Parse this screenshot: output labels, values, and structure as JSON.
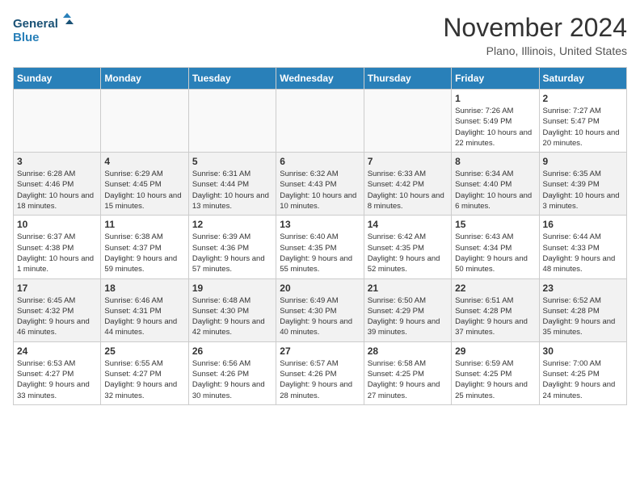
{
  "header": {
    "logo_line1": "General",
    "logo_line2": "Blue",
    "month": "November 2024",
    "location": "Plano, Illinois, United States"
  },
  "weekdays": [
    "Sunday",
    "Monday",
    "Tuesday",
    "Wednesday",
    "Thursday",
    "Friday",
    "Saturday"
  ],
  "weeks": [
    [
      {
        "day": "",
        "info": ""
      },
      {
        "day": "",
        "info": ""
      },
      {
        "day": "",
        "info": ""
      },
      {
        "day": "",
        "info": ""
      },
      {
        "day": "",
        "info": ""
      },
      {
        "day": "1",
        "info": "Sunrise: 7:26 AM\nSunset: 5:49 PM\nDaylight: 10 hours and 22 minutes."
      },
      {
        "day": "2",
        "info": "Sunrise: 7:27 AM\nSunset: 5:47 PM\nDaylight: 10 hours and 20 minutes."
      }
    ],
    [
      {
        "day": "3",
        "info": "Sunrise: 6:28 AM\nSunset: 4:46 PM\nDaylight: 10 hours and 18 minutes."
      },
      {
        "day": "4",
        "info": "Sunrise: 6:29 AM\nSunset: 4:45 PM\nDaylight: 10 hours and 15 minutes."
      },
      {
        "day": "5",
        "info": "Sunrise: 6:31 AM\nSunset: 4:44 PM\nDaylight: 10 hours and 13 minutes."
      },
      {
        "day": "6",
        "info": "Sunrise: 6:32 AM\nSunset: 4:43 PM\nDaylight: 10 hours and 10 minutes."
      },
      {
        "day": "7",
        "info": "Sunrise: 6:33 AM\nSunset: 4:42 PM\nDaylight: 10 hours and 8 minutes."
      },
      {
        "day": "8",
        "info": "Sunrise: 6:34 AM\nSunset: 4:40 PM\nDaylight: 10 hours and 6 minutes."
      },
      {
        "day": "9",
        "info": "Sunrise: 6:35 AM\nSunset: 4:39 PM\nDaylight: 10 hours and 3 minutes."
      }
    ],
    [
      {
        "day": "10",
        "info": "Sunrise: 6:37 AM\nSunset: 4:38 PM\nDaylight: 10 hours and 1 minute."
      },
      {
        "day": "11",
        "info": "Sunrise: 6:38 AM\nSunset: 4:37 PM\nDaylight: 9 hours and 59 minutes."
      },
      {
        "day": "12",
        "info": "Sunrise: 6:39 AM\nSunset: 4:36 PM\nDaylight: 9 hours and 57 minutes."
      },
      {
        "day": "13",
        "info": "Sunrise: 6:40 AM\nSunset: 4:35 PM\nDaylight: 9 hours and 55 minutes."
      },
      {
        "day": "14",
        "info": "Sunrise: 6:42 AM\nSunset: 4:35 PM\nDaylight: 9 hours and 52 minutes."
      },
      {
        "day": "15",
        "info": "Sunrise: 6:43 AM\nSunset: 4:34 PM\nDaylight: 9 hours and 50 minutes."
      },
      {
        "day": "16",
        "info": "Sunrise: 6:44 AM\nSunset: 4:33 PM\nDaylight: 9 hours and 48 minutes."
      }
    ],
    [
      {
        "day": "17",
        "info": "Sunrise: 6:45 AM\nSunset: 4:32 PM\nDaylight: 9 hours and 46 minutes."
      },
      {
        "day": "18",
        "info": "Sunrise: 6:46 AM\nSunset: 4:31 PM\nDaylight: 9 hours and 44 minutes."
      },
      {
        "day": "19",
        "info": "Sunrise: 6:48 AM\nSunset: 4:30 PM\nDaylight: 9 hours and 42 minutes."
      },
      {
        "day": "20",
        "info": "Sunrise: 6:49 AM\nSunset: 4:30 PM\nDaylight: 9 hours and 40 minutes."
      },
      {
        "day": "21",
        "info": "Sunrise: 6:50 AM\nSunset: 4:29 PM\nDaylight: 9 hours and 39 minutes."
      },
      {
        "day": "22",
        "info": "Sunrise: 6:51 AM\nSunset: 4:28 PM\nDaylight: 9 hours and 37 minutes."
      },
      {
        "day": "23",
        "info": "Sunrise: 6:52 AM\nSunset: 4:28 PM\nDaylight: 9 hours and 35 minutes."
      }
    ],
    [
      {
        "day": "24",
        "info": "Sunrise: 6:53 AM\nSunset: 4:27 PM\nDaylight: 9 hours and 33 minutes."
      },
      {
        "day": "25",
        "info": "Sunrise: 6:55 AM\nSunset: 4:27 PM\nDaylight: 9 hours and 32 minutes."
      },
      {
        "day": "26",
        "info": "Sunrise: 6:56 AM\nSunset: 4:26 PM\nDaylight: 9 hours and 30 minutes."
      },
      {
        "day": "27",
        "info": "Sunrise: 6:57 AM\nSunset: 4:26 PM\nDaylight: 9 hours and 28 minutes."
      },
      {
        "day": "28",
        "info": "Sunrise: 6:58 AM\nSunset: 4:25 PM\nDaylight: 9 hours and 27 minutes."
      },
      {
        "day": "29",
        "info": "Sunrise: 6:59 AM\nSunset: 4:25 PM\nDaylight: 9 hours and 25 minutes."
      },
      {
        "day": "30",
        "info": "Sunrise: 7:00 AM\nSunset: 4:25 PM\nDaylight: 9 hours and 24 minutes."
      }
    ]
  ]
}
